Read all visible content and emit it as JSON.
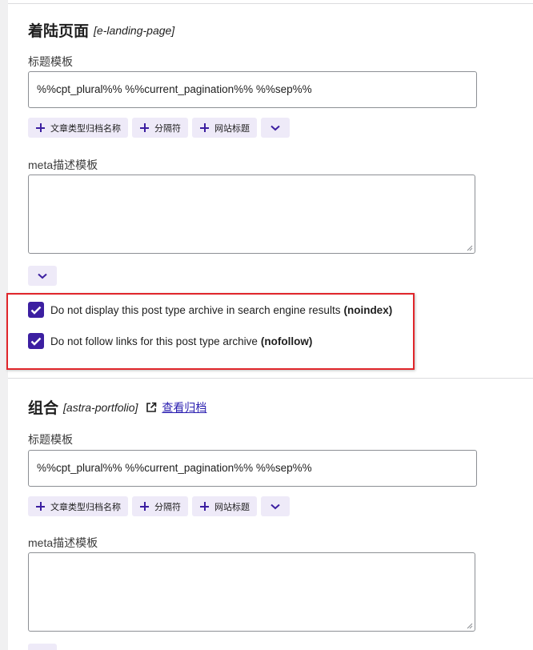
{
  "sections": [
    {
      "title": "着陆页面",
      "slug": "[e-landing-page]",
      "title_template_label": "标题模板",
      "title_template_value": "%%cpt_plural%% %%current_pagination%% %%sep%%",
      "variable_buttons": [
        "文章类型归档名称",
        "分隔符",
        "网站标题"
      ],
      "meta_label": "meta描述模板",
      "meta_value": "",
      "noindex_text": "Do not display this post type archive in search engine results",
      "noindex_tag": "(noindex)",
      "noindex_checked": true,
      "nofollow_text": "Do not follow links for this post type archive",
      "nofollow_tag": "(nofollow)",
      "nofollow_checked": true
    },
    {
      "title": "组合",
      "slug": "[astra-portfolio]",
      "view_archive_link": "查看归档",
      "title_template_label": "标题模板",
      "title_template_value": "%%cpt_plural%% %%current_pagination%% %%sep%%",
      "variable_buttons": [
        "文章类型归档名称",
        "分隔符",
        "网站标题"
      ],
      "meta_label": "meta描述模板",
      "meta_value": ""
    }
  ],
  "colors": {
    "accent": "#3c1fa1",
    "highlight_border": "#e0262b",
    "link": "#2a1eb0"
  },
  "icons": {
    "add": "plus-icon",
    "expand": "chevron-down-icon",
    "external": "external-link-icon",
    "check": "checkmark-icon"
  }
}
